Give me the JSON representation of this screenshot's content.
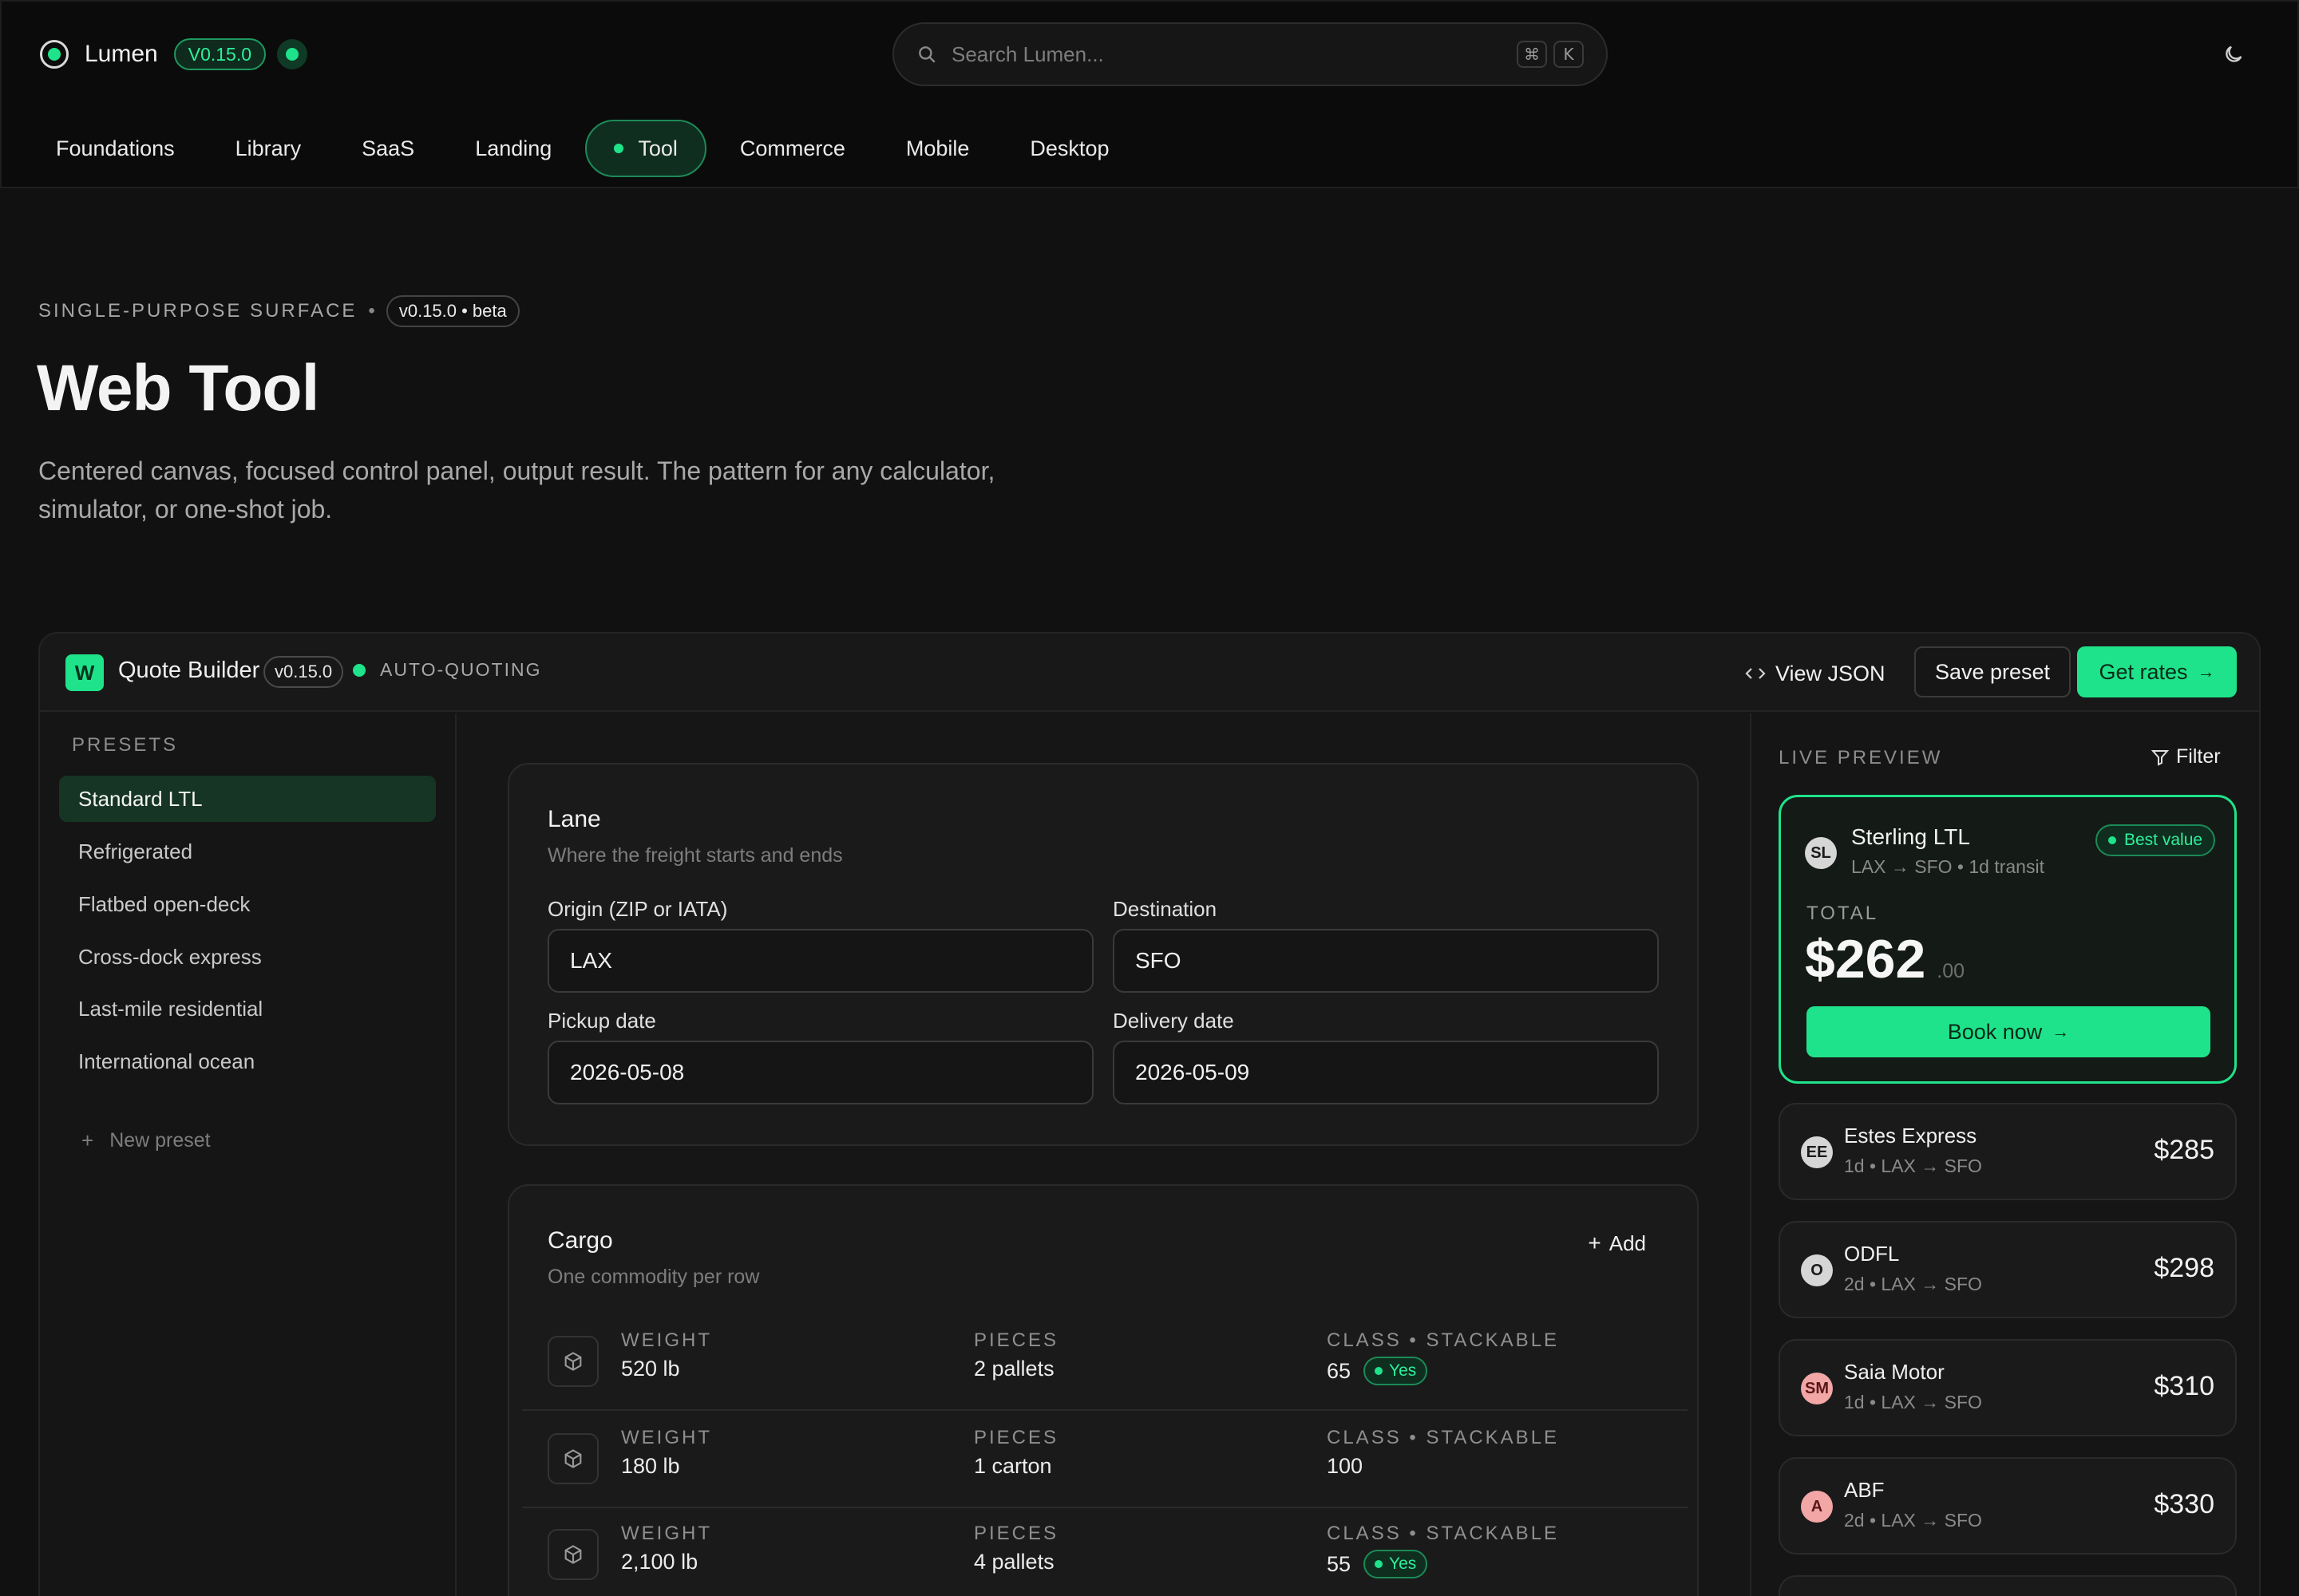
{
  "header": {
    "brand": "Lumen",
    "version": "V0.15.0",
    "search_placeholder": "Search Lumen...",
    "shortcut_mod": "⌘",
    "shortcut_key": "K"
  },
  "nav": {
    "items": [
      {
        "label": "Foundations"
      },
      {
        "label": "Library"
      },
      {
        "label": "SaaS"
      },
      {
        "label": "Landing"
      },
      {
        "label": "Tool",
        "active": true
      },
      {
        "label": "Commerce"
      },
      {
        "label": "Mobile"
      },
      {
        "label": "Desktop"
      }
    ]
  },
  "hero": {
    "eyebrow": "SINGLE-PURPOSE SURFACE",
    "eyebrow_sep": "•",
    "version_pill": "v0.15.0 • beta",
    "title": "Web Tool",
    "subtitle": "Centered canvas, focused control panel, output result. The pattern for any calculator, simulator, or one-shot job."
  },
  "app": {
    "logo_letter": "W",
    "name": "Quote Builder",
    "version": "v0.15.0",
    "status": "AUTO-QUOTING",
    "view_json": "View JSON",
    "save_preset": "Save preset",
    "get_rates": "Get rates",
    "arrow": "→"
  },
  "presets": {
    "title": "PRESETS",
    "items": [
      "Standard LTL",
      "Refrigerated",
      "Flatbed open-deck",
      "Cross-dock express",
      "Last-mile residential",
      "International ocean"
    ],
    "new_label": "New preset",
    "plus": "+"
  },
  "lane": {
    "title": "Lane",
    "subtitle": "Where the freight starts and ends",
    "origin_label": "Origin (ZIP or IATA)",
    "origin_value": "LAX",
    "destination_label": "Destination",
    "destination_value": "SFO",
    "pickup_label": "Pickup date",
    "pickup_value": "2026-05-08",
    "delivery_label": "Delivery date",
    "delivery_value": "2026-05-09"
  },
  "cargo": {
    "title": "Cargo",
    "subtitle": "One commodity per row",
    "add_label": "Add",
    "col_weight": "WEIGHT",
    "col_pieces": "PIECES",
    "col_class": "CLASS • STACKABLE",
    "yes_label": "Yes",
    "rows": [
      {
        "weight": "520 lb",
        "pieces": "2 pallets",
        "class": "65",
        "stackable": true
      },
      {
        "weight": "180 lb",
        "pieces": "1 carton",
        "class": "100",
        "stackable": false
      },
      {
        "weight": "2,100 lb",
        "pieces": "4 pallets",
        "class": "55",
        "stackable": true
      }
    ]
  },
  "preview": {
    "title": "LIVE PREVIEW",
    "filter": "Filter",
    "best": {
      "initials": "SL",
      "carrier": "Sterling LTL",
      "route": "LAX → SFO • 1d transit",
      "badge": "Best value",
      "total_label": "TOTAL",
      "total": "$262",
      "cents": ".00",
      "book": "Book now"
    },
    "quotes": [
      {
        "initials": "EE",
        "carrier": "Estes Express",
        "route": "1d • LAX → SFO",
        "price": "$285",
        "tone": "grey"
      },
      {
        "initials": "O",
        "carrier": "ODFL",
        "route": "2d • LAX → SFO",
        "price": "$298",
        "tone": "grey"
      },
      {
        "initials": "SM",
        "carrier": "Saia Motor",
        "route": "1d • LAX → SFO",
        "price": "$310",
        "tone": "pink"
      },
      {
        "initials": "A",
        "carrier": "ABF",
        "route": "2d • LAX → SFO",
        "price": "$330",
        "tone": "pink"
      }
    ]
  },
  "colors": {
    "accent": "#1fe38a",
    "background": "#111111",
    "panel": "#161616"
  }
}
